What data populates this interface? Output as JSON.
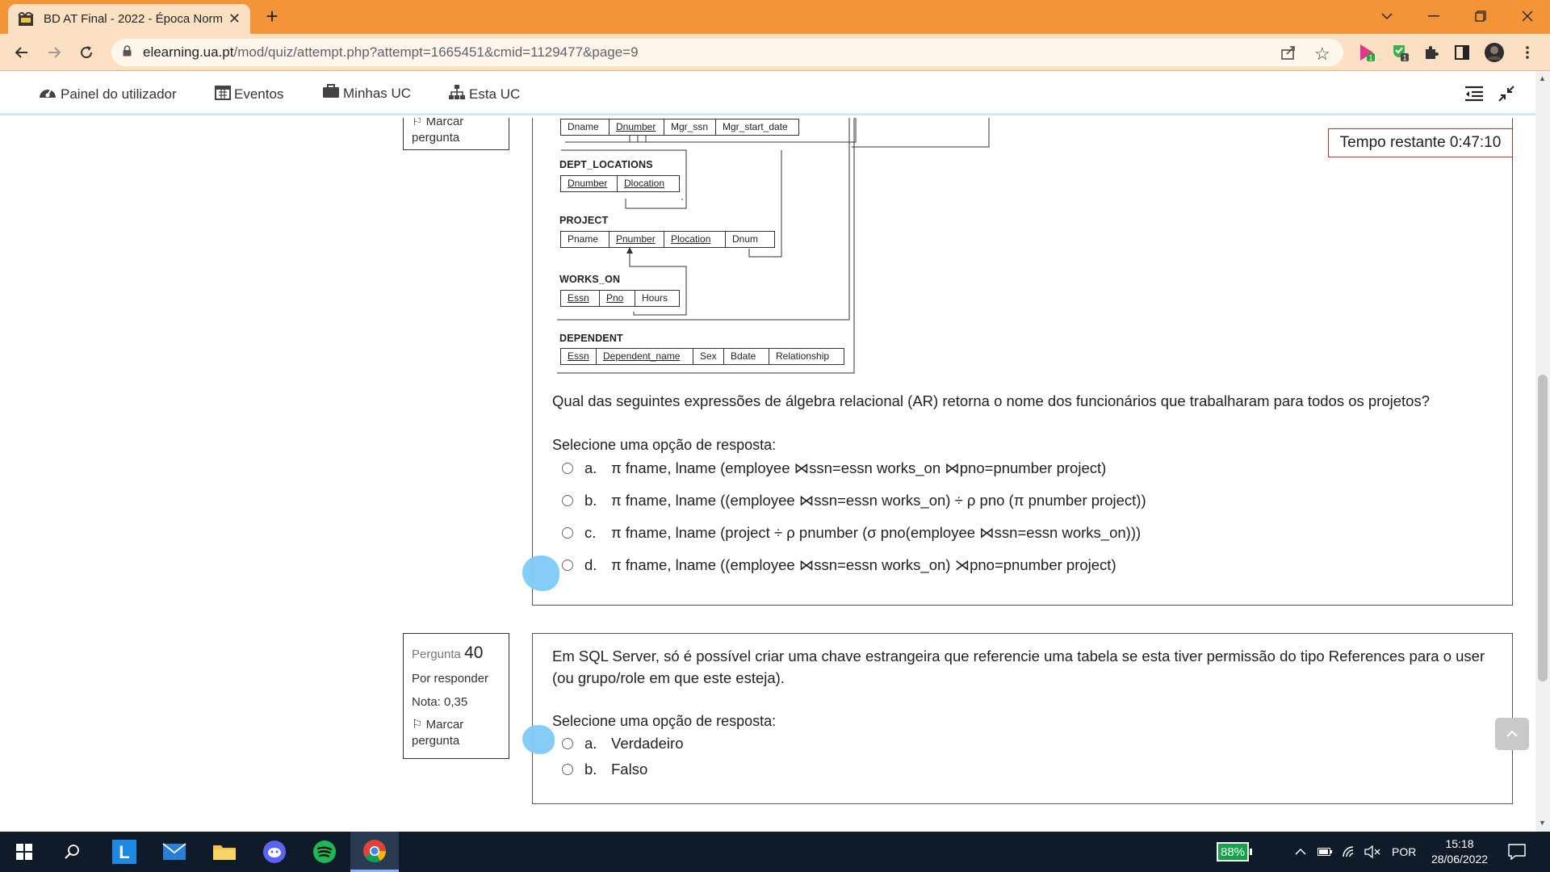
{
  "browser": {
    "tab_title": "BD AT Final - 2022 - Época Norm",
    "url_host": "elearning.ua.pt",
    "url_path": "/mod/quiz/attempt.php?attempt=1665451&cmid=1129477&page=9",
    "accent": "#f39438"
  },
  "nav": {
    "dashboard": "Painel do utilizador",
    "events": "Eventos",
    "my_courses": "Minhas UC",
    "this_course": "Esta UC"
  },
  "timer": "Tempo restante 0:47:10",
  "q39": {
    "flag_top": "Marcar",
    "flag_bottom": "pergunta",
    "schema": {
      "department": [
        "Dname",
        "Dnumber",
        "Mgr_ssn",
        "Mgr_start_date"
      ],
      "dept_locations": {
        "name": "DEPT_LOCATIONS",
        "cols": [
          "Dnumber",
          "Dlocation"
        ]
      },
      "project": {
        "name": "PROJECT",
        "cols": [
          "Pname",
          "Pnumber",
          "Plocation",
          "Dnum"
        ]
      },
      "works_on": {
        "name": "WORKS_ON",
        "cols": [
          "Essn",
          "Pno",
          "Hours"
        ]
      },
      "dependent": {
        "name": "DEPENDENT",
        "cols": [
          "Essn",
          "Dependent_name",
          "Sex",
          "Bdate",
          "Relationship"
        ]
      }
    },
    "text": "Qual das seguintes expressões de álgebra relacional (AR) retorna o nome dos funcionários que trabalharam para todos os projetos?",
    "prompt": "Selecione uma opção de resposta:",
    "options": [
      {
        "label": "a.",
        "text": "π fname, lname (employee ⋈ssn=essn works_on ⋈pno=pnumber project)"
      },
      {
        "label": "b.",
        "text": "π fname, lname ((employee ⋈ssn=essn works_on) ÷ ρ pno (π pnumber project))"
      },
      {
        "label": "c.",
        "text": "π fname, lname (project ÷ ρ pnumber (σ pno(employee ⋈ssn=essn works_on)))"
      },
      {
        "label": "d.",
        "text": "π fname, lname ((employee ⋈ssn=essn works_on) ⋊pno=pnumber project)"
      }
    ]
  },
  "q40": {
    "label": "Pergunta",
    "number": "40",
    "status": "Por responder",
    "grade": "Nota: 0,35",
    "flag_top": "Marcar",
    "flag_bottom": "pergunta",
    "text": "Em SQL Server, só é possível criar uma chave estrangeira que referencie uma tabela se esta tiver permissão do tipo References para o user (ou grupo/role em que este esteja).",
    "prompt": "Selecione uma opção de resposta:",
    "options": [
      {
        "label": "a.",
        "text": "Verdadeiro"
      },
      {
        "label": "b.",
        "text": "Falso"
      }
    ]
  },
  "taskbar": {
    "battery": "88%",
    "language": "POR",
    "time": "15:18",
    "date": "28/06/2022"
  }
}
